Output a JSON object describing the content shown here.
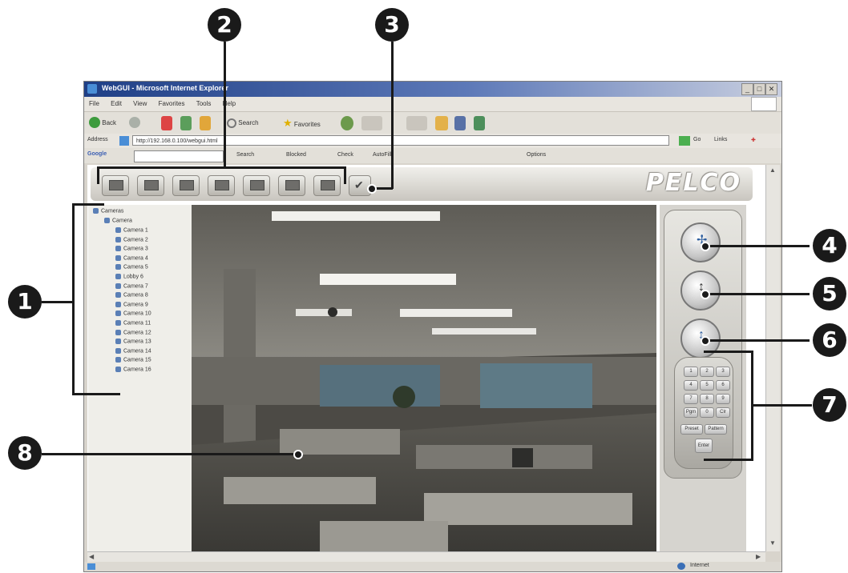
{
  "callouts": [
    "1",
    "2",
    "3",
    "4",
    "5",
    "6",
    "7",
    "8"
  ],
  "window": {
    "title": "WebGUI - Microsoft Internet Explorer",
    "menu": [
      "File",
      "Edit",
      "View",
      "Favorites",
      "Tools",
      "Help"
    ],
    "toolbar": {
      "back": "Back",
      "search": "Search",
      "favorites": "Favorites"
    },
    "address_label": "Address",
    "address": "http://192.168.0.100/webgui.html",
    "go": "Go",
    "links": "Links",
    "google_label": "Google",
    "google_buttons": {
      "search": "Search",
      "blocked": "Blocked",
      "check": "Check",
      "autofill": "AutoFill",
      "options": "Options"
    },
    "status_zone": "Internet"
  },
  "app": {
    "brand": "PELCO",
    "tree": {
      "root": "Cameras",
      "group": "Camera",
      "items": [
        "Camera 1",
        "Camera 2",
        "Camera 3",
        "Camera 4",
        "Camera 5",
        "Lobby 6",
        "Camera 7",
        "Camera 8",
        "Camera 9",
        "Camera 10",
        "Camera 11",
        "Camera 12",
        "Camera 13",
        "Camera 14",
        "Camera 15",
        "Camera 16"
      ]
    },
    "keypad": [
      "1",
      "2",
      "3",
      "4",
      "5",
      "6",
      "7",
      "8",
      "9",
      "Pgm",
      "0",
      "Clr"
    ],
    "keypad_wide": [
      "Preset",
      "Pattern"
    ],
    "keypad_bottom": "Enter"
  },
  "colors": {
    "callout": "#1a1a1a",
    "titlebar": "#1f3f86",
    "brand_text": "#ffffff"
  }
}
